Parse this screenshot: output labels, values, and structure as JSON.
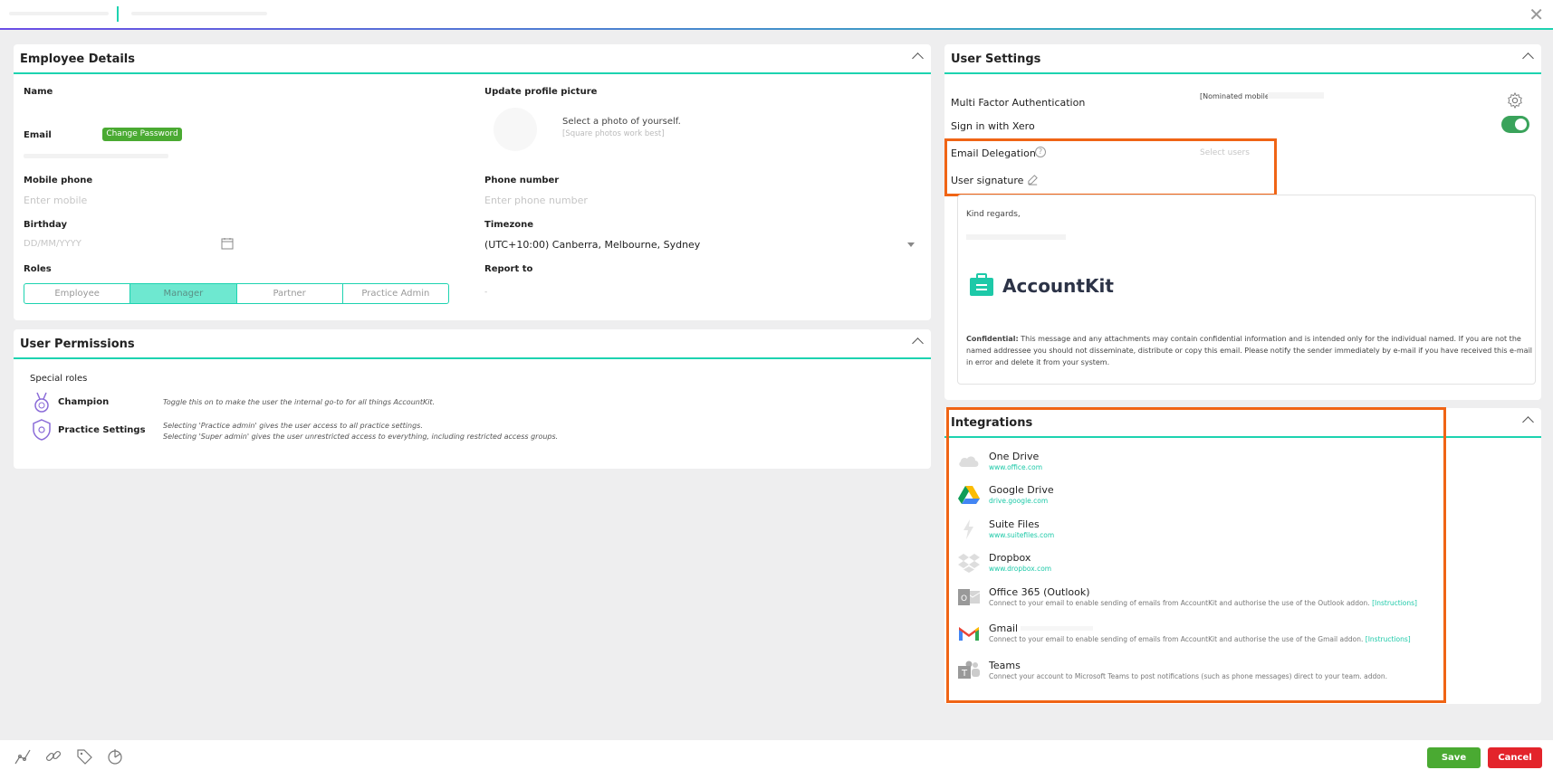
{
  "employee_details": {
    "title": "Employee Details",
    "name_label": "Name",
    "email_label": "Email",
    "change_password": "Change Password",
    "update_picture_label": "Update profile picture",
    "photo_hint": "Select a photo of yourself.",
    "photo_subhint": "[Square photos work best]",
    "mobile_label": "Mobile phone",
    "mobile_placeholder": "Enter mobile",
    "phone_label": "Phone number",
    "phone_placeholder": "Enter phone number",
    "birthday_label": "Birthday",
    "birthday_placeholder": "DD/MM/YYYY",
    "timezone_label": "Timezone",
    "timezone_value": "(UTC+10:00) Canberra, Melbourne, Sydney",
    "roles_label": "Roles",
    "roles": [
      "Employee",
      "Manager",
      "Partner",
      "Practice Admin"
    ],
    "active_role": "Manager",
    "report_to_label": "Report to",
    "report_to_value": "-"
  },
  "user_permissions": {
    "title": "User Permissions",
    "special_roles_label": "Special roles",
    "items": [
      {
        "name": "Champion",
        "desc": "Toggle this on to make the user the internal go-to for all things AccountKit.",
        "icon": "medal-icon"
      },
      {
        "name": "Practice Settings",
        "desc": "Selecting 'Practice admin' gives the user access to all practice settings.",
        "desc2": "Selecting 'Super admin' gives the user unrestricted access to everything, including restricted access groups.",
        "icon": "shield-gear-icon"
      }
    ]
  },
  "user_settings": {
    "title": "User Settings",
    "mfa_label": "Multi Factor Authentication",
    "nominated_mobile": "[Nominated mobile",
    "xero_label": "Sign in with Xero",
    "xero_enabled": true,
    "email_delegation_label": "Email Delegation",
    "select_users_placeholder": "Select users",
    "signature_label": "User signature",
    "signature": {
      "greeting": "Kind regards,",
      "brand": "AccountKit",
      "confidential_label": "Confidential:",
      "confidential_text": " This message and any attachments may contain confidential information and is intended only for the individual named. If you are not the named addressee you should not disseminate, distribute or copy this email. Please notify the sender immediately by e-mail if you have received this e-mail in error and delete it from your system."
    }
  },
  "integrations": {
    "title": "Integrations",
    "items": [
      {
        "name": "One Drive",
        "link": "www.office.com",
        "icon": "cloud-icon"
      },
      {
        "name": "Google Drive",
        "link": "drive.google.com",
        "icon": "google-drive-icon"
      },
      {
        "name": "Suite Files",
        "link": "www.suitefiles.com",
        "icon": "suitefiles-icon"
      },
      {
        "name": "Dropbox",
        "link": "www.dropbox.com",
        "icon": "dropbox-icon"
      },
      {
        "name": "Office 365 (Outlook)",
        "desc": "Connect to your email to enable sending of emails from AccountKit and authorise the use of the Outlook addon.",
        "instructions": "[Instructions]",
        "icon": "outlook-icon"
      },
      {
        "name": "Gmail",
        "desc": "Connect to your email to enable sending of emails from AccountKit and authorise the use of the Gmail addon.",
        "instructions": "[Instructions]",
        "icon": "gmail-icon"
      },
      {
        "name": "Teams",
        "desc": "Connect your account to Microsoft Teams to post notifications (such as phone messages) direct to your team. addon.",
        "icon": "teams-icon"
      }
    ]
  },
  "footer": {
    "save": "Save",
    "cancel": "Cancel"
  },
  "colors": {
    "accent": "#1dd3b0",
    "save": "#4aaa32",
    "cancel": "#e3242b",
    "highlight": "#f06415"
  }
}
